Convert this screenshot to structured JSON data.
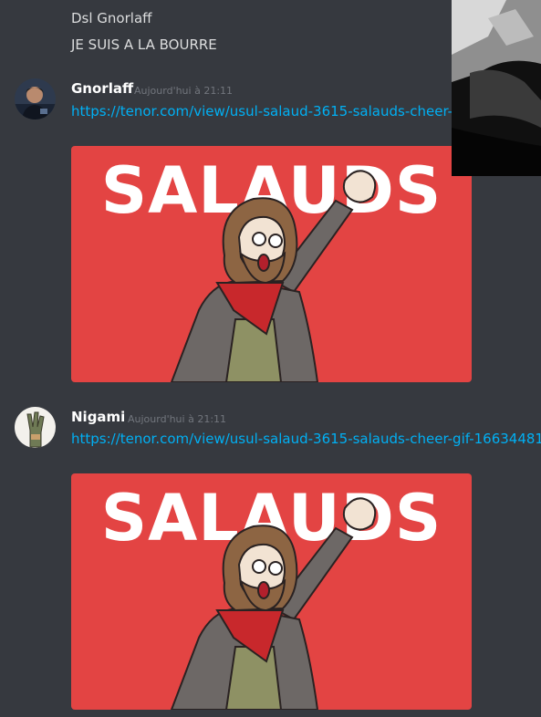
{
  "messages": [
    {
      "text": "Dsl Gnorlaff"
    },
    {
      "text": "JE SUIS A LA BOURRE"
    }
  ],
  "posts": [
    {
      "username": "Gnorlaff",
      "timestamp": "Aujourd'hui à 21:11",
      "link": "https://tenor.com/view/usul-salaud-3615-salauds-cheer-gif-16634481",
      "gif_text": "SALAUDS"
    },
    {
      "username": "Nigami",
      "timestamp": "Aujourd'hui à 21:11",
      "link": "https://tenor.com/view/usul-salaud-3615-salauds-cheer-gif-16634481",
      "gif_text": "SALAUDS"
    }
  ],
  "colors": {
    "background": "#36393f",
    "link": "#00b0f4",
    "timestamp": "#72767d",
    "gif_background": "#e34443"
  }
}
